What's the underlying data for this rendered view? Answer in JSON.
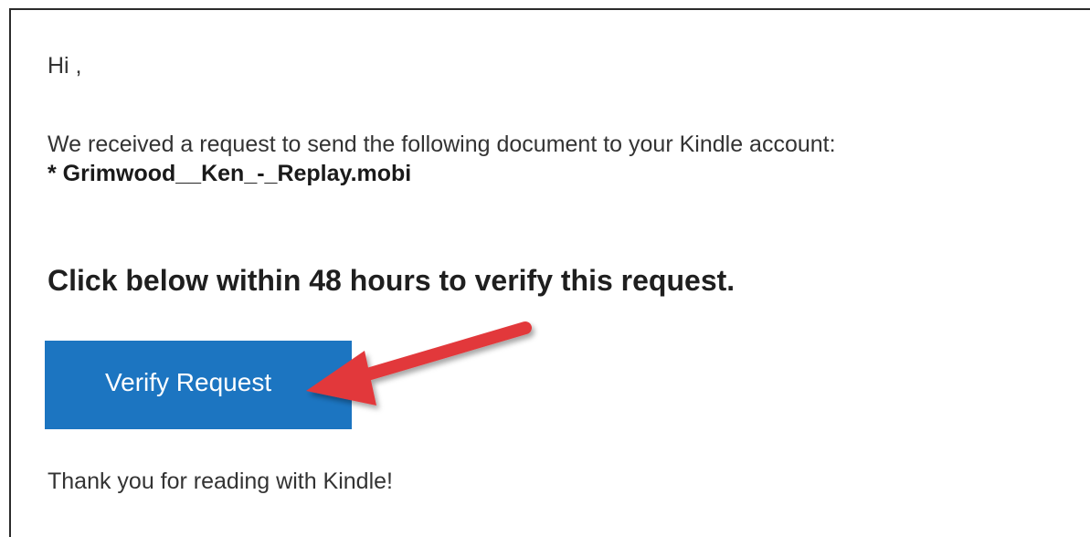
{
  "email": {
    "greeting": "Hi ,",
    "intro": "We received a request to send the following document to your Kindle account:",
    "filename": "* Grimwood__Ken_-_Replay.mobi",
    "headline": "Click below within 48 hours to verify this request.",
    "verify_label": "Verify Request",
    "closing": "Thank you for reading with Kindle!"
  },
  "colors": {
    "button": "#1c75c1",
    "arrow": "#e2393b",
    "text": "#333333"
  },
  "annotation": {
    "icon": "red-arrow-icon"
  }
}
